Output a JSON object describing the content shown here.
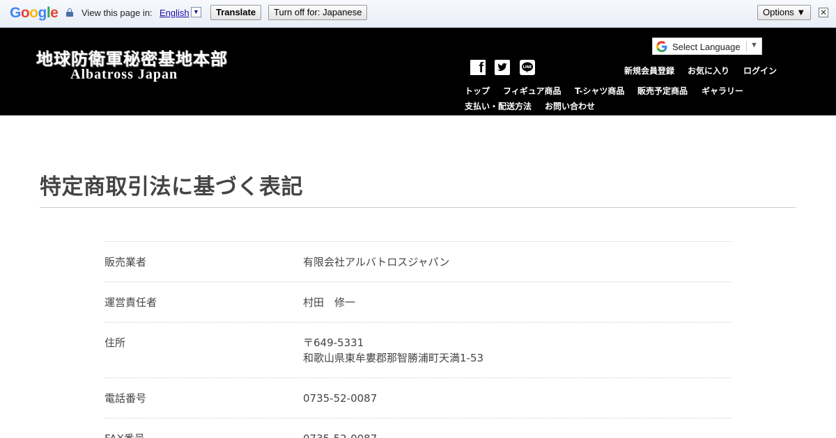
{
  "translate_bar": {
    "logo": "Google",
    "prompt": "View this page in:",
    "language": "English",
    "translate_label": "Translate",
    "turn_off_label": "Turn off for: Japanese",
    "options_label": "Options ▼",
    "close_glyph": "✕"
  },
  "header": {
    "logo_jp": "地球防衛軍秘密基地本部",
    "logo_en": "Albatross Japan",
    "select_language": "Select Language",
    "select_arrow": "▼",
    "social_icons": [
      "facebook-icon",
      "twitter-icon",
      "line-icon"
    ],
    "account_links": [
      "新規会員登録",
      "お気に入り",
      "ログイン"
    ],
    "nav_row1": [
      "トップ",
      "フィギュア商品",
      "T-シャツ商品",
      "販売予定商品",
      "ギャラリー"
    ],
    "nav_row2": [
      "支払い・配送方法",
      "お問い合わせ"
    ]
  },
  "main": {
    "title": "特定商取引法に基づく表記",
    "rows": [
      {
        "label": "販売業者",
        "value": "有限会社アルバトロスジャパン"
      },
      {
        "label": "運営責任者",
        "value": "村田　修一"
      },
      {
        "label": "住所",
        "value": "〒649-5331",
        "value2": "和歌山県東牟婁郡那智勝浦町天満1-53"
      },
      {
        "label": "電話番号",
        "value": "0735-52-0087"
      },
      {
        "label": "FAX番号",
        "value": "0735-52-0087"
      }
    ]
  },
  "colors": {
    "header_bg": "#000000",
    "link_blue": "#1a0dab",
    "text": "#444444"
  }
}
